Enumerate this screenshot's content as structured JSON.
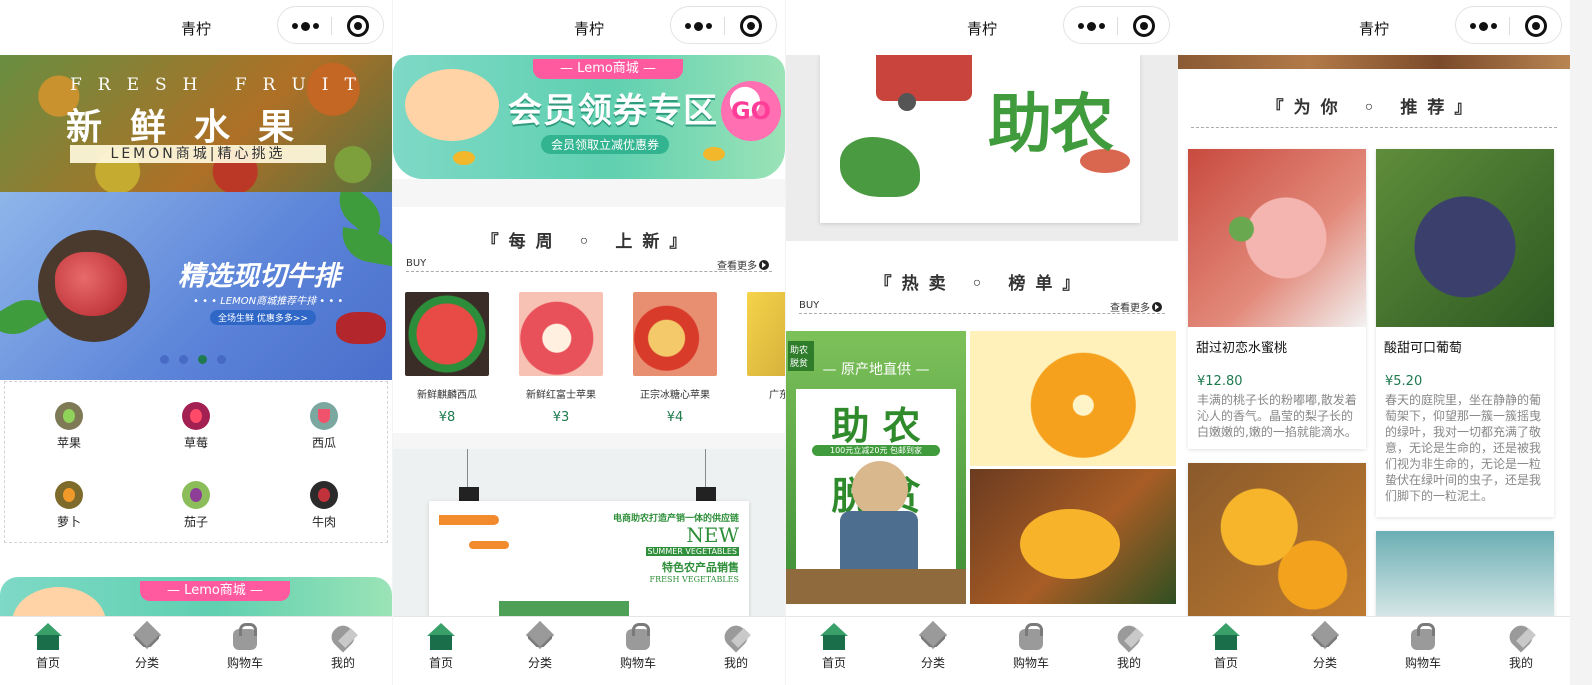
{
  "app": {
    "title": "青柠"
  },
  "tabbar": [
    {
      "label": "首页",
      "icon": "home-icon"
    },
    {
      "label": "分类",
      "icon": "category-icon"
    },
    {
      "label": "购物车",
      "icon": "cart-icon"
    },
    {
      "label": "我的",
      "icon": "profile-icon"
    }
  ],
  "home": {
    "banner_fruit": {
      "en": "FRESH FRUIT",
      "cn": "新鲜水果",
      "tag": "LEMON商城|精心挑选"
    },
    "banner_steak": {
      "title": "精选现切牛排",
      "sub": "• • •  LEMON商城推荐牛排  • • •",
      "badge": "全场生鲜 优惠多多>>"
    },
    "carousel": {
      "count": 4,
      "active_index": 2
    },
    "categories": [
      {
        "label": "苹果",
        "icon": "apple-icon"
      },
      {
        "label": "草莓",
        "icon": "strawberry-icon"
      },
      {
        "label": "西瓜",
        "icon": "watermelon-icon"
      },
      {
        "label": "萝卜",
        "icon": "carrot-icon"
      },
      {
        "label": "茄子",
        "icon": "eggplant-icon"
      },
      {
        "label": "牛肉",
        "icon": "beef-icon"
      }
    ],
    "coupon_pill": "— Lemo商城 —"
  },
  "coupon": {
    "pill": "— Lemo商城 —",
    "title": "会员领券专区",
    "sub": "会员领取立减优惠券",
    "go": "GO"
  },
  "weekly": {
    "title": "『每周 ◦ 上新』",
    "left": "BUY",
    "more": "查看更多",
    "products": [
      {
        "name": "新鲜麒麟西瓜",
        "price": "¥8"
      },
      {
        "name": "新鲜红富士苹果",
        "price": "¥3"
      },
      {
        "name": "正宗冰糖心苹果",
        "price": "¥4"
      },
      {
        "name": "广东网纹",
        "price": "¥"
      }
    ]
  },
  "veg_poster": {
    "line1": "电商助农打造产销一体的供应链",
    "line2": "NEW",
    "line3": "SUMMER VEGETABLES",
    "line4": "特色农产品销售",
    "line5": "FRESH VEGETABLES"
  },
  "help_poster": {
    "title": "助农"
  },
  "hot": {
    "title": "『热卖 ◦ 榜单』",
    "left": "BUY",
    "more": "查看更多",
    "farm": {
      "top": "— 原产地直供 —",
      "big1": "助 农",
      "mid": "100元立减20元 包邮到家",
      "big2": "脱 贫",
      "corner": "助农脱贫"
    }
  },
  "recommend": {
    "title": "『为你 ◦ 推荐』",
    "items": [
      {
        "name": "甜过初恋水蜜桃",
        "price": "¥12.80",
        "desc": "丰满的桃子长的粉嘟嘟,散发着沁人的香气。晶莹的梨子长的白嫩嫩的,嫩的一掐就能滴水。"
      },
      {
        "name": "酸甜可口葡萄",
        "price": "¥5.20",
        "desc": "春天的庭院里，坐在静静的葡萄架下，仰望那一簇一簇摇曳的绿叶，我对一切都充满了敬意，无论是生命的，还是被我们视为非生命的，无论是一粒蛰伏在绿叶间的虫子，还是我们脚下的一粒泥土。"
      }
    ]
  },
  "colors": {
    "accent": "#1f7a4f",
    "price": "#1f7a4f",
    "coupon": "#5fd0b0",
    "pill": "#ff5aa0"
  }
}
